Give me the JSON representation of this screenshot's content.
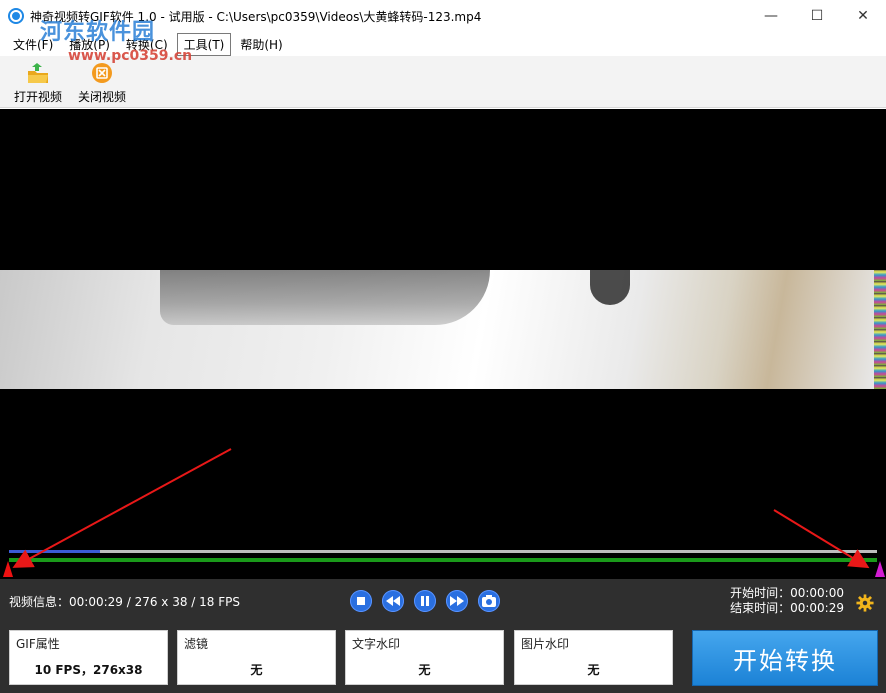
{
  "window": {
    "title": "神奇视频转GIF软件 1.0 - 试用版 - C:\\Users\\pc0359\\Videos\\大黄蜂转码-123.mp4",
    "minimize": "—",
    "maximize": "☐",
    "close": "✕"
  },
  "watermark": {
    "site_name": "河东软件园",
    "url": "www.pc0359.cn"
  },
  "menu": {
    "items": [
      {
        "label": "文件(F)"
      },
      {
        "label": "播放(P)"
      },
      {
        "label": "转换(C)"
      },
      {
        "label": "工具(T)"
      },
      {
        "label": "帮助(H)"
      }
    ]
  },
  "toolbar": {
    "open_video": "打开视频",
    "close_video": "关闭视频"
  },
  "status": {
    "video_info": "视频信息：00:00:29 / 276 x 38 / 18 FPS",
    "start_time_label": "开始时间：",
    "start_time": "00:00:00",
    "end_time_label": "结束时间：",
    "end_time": "00:00:29"
  },
  "playback": {
    "progress": 0.105
  },
  "panels": {
    "gif": {
      "label": "GIF属性",
      "value": "10 FPS，276x38"
    },
    "filter": {
      "label": "滤镜",
      "value": "无"
    },
    "text_watermark": {
      "label": "文字水印",
      "value": "无"
    },
    "image_watermark": {
      "label": "图片水印",
      "value": "无"
    }
  },
  "actions": {
    "start_convert": "开始转换"
  },
  "colors": {
    "accent_blue": "#2a6fe0",
    "start_button": "#1c82d6",
    "range_start_marker": "#ee1111",
    "range_end_marker": "#d21cd2",
    "range_bar": "#1a9a1a"
  }
}
